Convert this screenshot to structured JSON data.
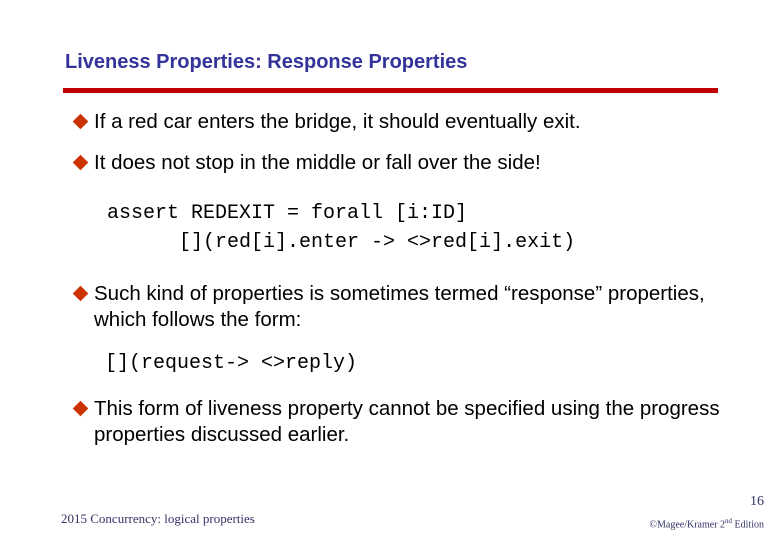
{
  "slide": {
    "title": "Liveness Properties: Response Properties",
    "accent_colors": {
      "title": "#333399",
      "rule": "#c00000",
      "bullet": "#cc3300"
    },
    "bullets": [
      {
        "icon": "diamond-bullet-icon",
        "text": "If a red car enters the bridge, it should eventually exit."
      },
      {
        "icon": "diamond-bullet-icon",
        "text": "It does not stop in the middle or fall over the side!"
      },
      {
        "icon": "diamond-bullet-icon",
        "text": "Such kind of properties is sometimes termed “response” properties, which follows the form:"
      },
      {
        "icon": "diamond-bullet-icon",
        "text": "This form of liveness property cannot be specified using the progress properties discussed earlier."
      }
    ],
    "code_blocks": [
      {
        "lines": [
          "assert REDEXIT = forall [i:ID]",
          "      [](red[i].enter -> <>red[i].exit)"
        ]
      },
      {
        "lines": [
          "[](request-> <>reply)"
        ]
      }
    ]
  },
  "footer": {
    "left_text": "2015 Concurrency: logical properties",
    "page_number": "16",
    "copyright_prefix": "©Magee/Kramer 2",
    "copyright_sup": "nd",
    "copyright_suffix": " Edition"
  }
}
